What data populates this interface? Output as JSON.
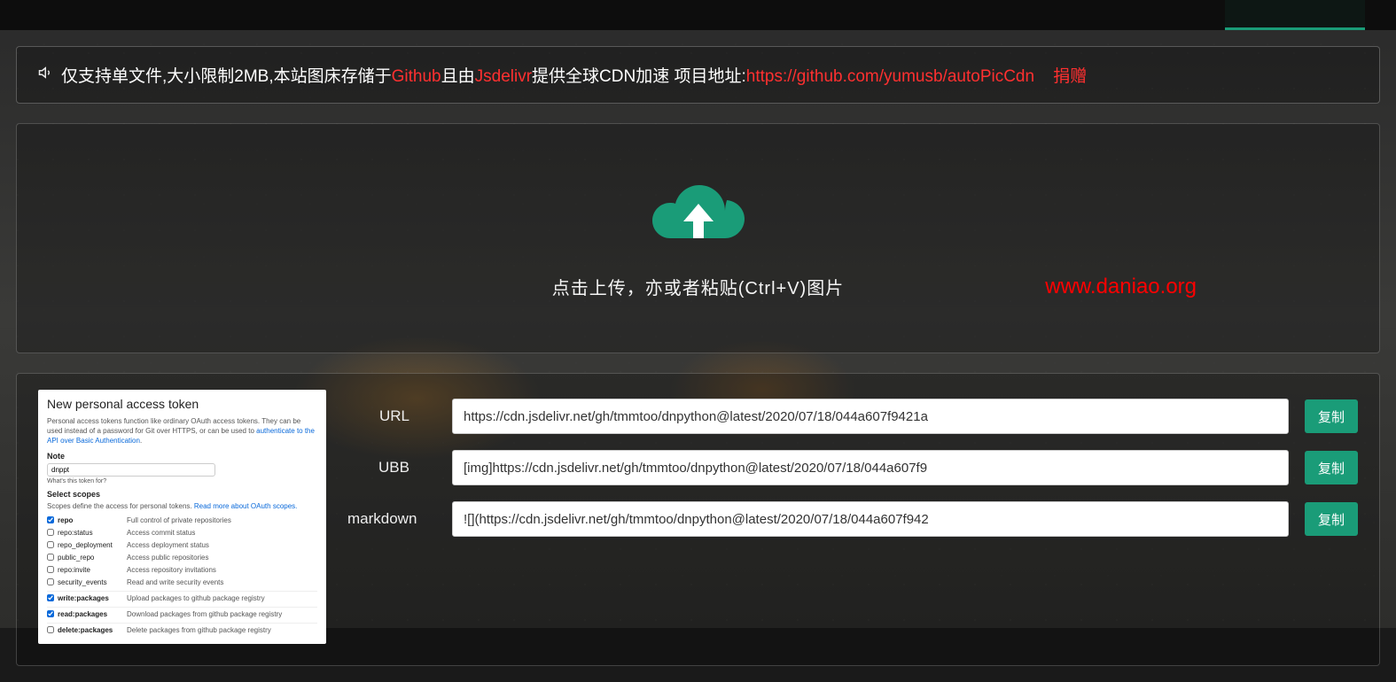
{
  "notice": {
    "prefix1": "仅支持单文件,大小限制2MB,本站图床存储于",
    "github": "Github",
    "mid1": "且由",
    "jsdelivr": "Jsdelivr",
    "mid2": "提供全球CDN加速    项目地址:",
    "project_url": "https://github.com/yumusb/autoPicCdn",
    "donate": "捐赠"
  },
  "upload": {
    "hint": "点击上传，亦或者粘贴(Ctrl+V)图片"
  },
  "watermark": "www.daniao.org",
  "outputs": [
    {
      "label": "URL",
      "value": "https://cdn.jsdelivr.net/gh/tmmtoo/dnpython@latest/2020/07/18/044a607f9421a",
      "copy": "复制"
    },
    {
      "label": "UBB",
      "value": "[img]https://cdn.jsdelivr.net/gh/tmmtoo/dnpython@latest/2020/07/18/044a607f9",
      "copy": "复制"
    },
    {
      "label": "markdown",
      "value": "![](https://cdn.jsdelivr.net/gh/tmmtoo/dnpython@latest/2020/07/18/044a607f942",
      "copy": "复制"
    }
  ],
  "token_card": {
    "title": "New personal access token",
    "desc_pre": "Personal access tokens function like ordinary OAuth access tokens. They can be used instead of a password for Git over HTTPS, or can be used to ",
    "desc_link": "authenticate to the API over Basic Authentication",
    "note_label": "Note",
    "note_value": "dnppt",
    "note_hint": "What's this token for?",
    "scopes_label": "Select scopes",
    "scopes_desc": "Scopes define the access for personal tokens. ",
    "scopes_link": "Read more about OAuth scopes.",
    "scopes": [
      {
        "checked": true,
        "name": "repo",
        "desc": "Full control of private repositories",
        "bold": true
      },
      {
        "checked": false,
        "name": "repo:status",
        "desc": "Access commit status"
      },
      {
        "checked": false,
        "name": "repo_deployment",
        "desc": "Access deployment status"
      },
      {
        "checked": false,
        "name": "public_repo",
        "desc": "Access public repositories"
      },
      {
        "checked": false,
        "name": "repo:invite",
        "desc": "Access repository invitations"
      },
      {
        "checked": false,
        "name": "security_events",
        "desc": "Read and write security events"
      },
      {
        "checked": true,
        "name": "write:packages",
        "desc": "Upload packages to github package registry",
        "bold": true,
        "sep": true
      },
      {
        "checked": true,
        "name": "read:packages",
        "desc": "Download packages from github package registry",
        "bold": true,
        "sep": true
      },
      {
        "checked": false,
        "name": "delete:packages",
        "desc": "Delete packages from github package registry",
        "bold": true,
        "sep": true
      }
    ]
  }
}
